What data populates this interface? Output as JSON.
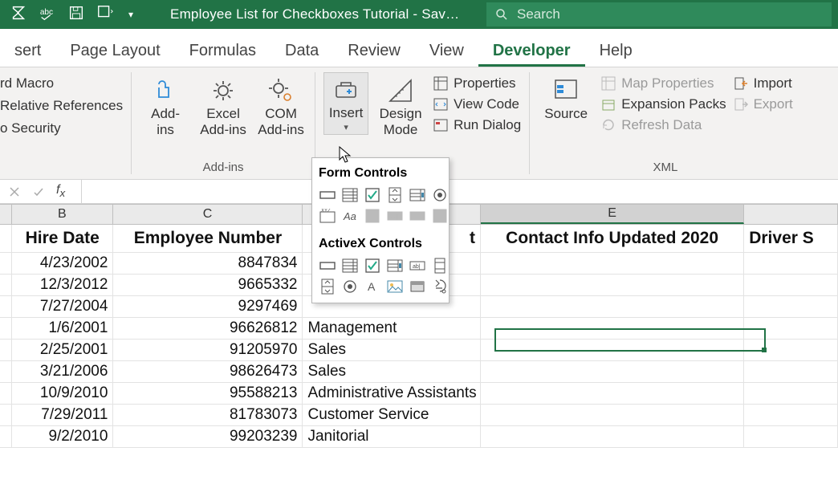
{
  "titlebar": {
    "title": "Employee List for Checkboxes Tutorial  -  Sav…",
    "search_placeholder": "Search"
  },
  "tabs": [
    "sert",
    "Page Layout",
    "Formulas",
    "Data",
    "Review",
    "View",
    "Developer",
    "Help"
  ],
  "active_tab": "Developer",
  "ribbon": {
    "code": {
      "items": [
        "rd Macro",
        "Relative References",
        "o Security"
      ]
    },
    "addins": {
      "label": "Add-ins",
      "buttons": [
        "Add-\nins",
        "Excel\nAdd-ins",
        "COM\nAdd-ins"
      ]
    },
    "controls": {
      "insert": "Insert",
      "design": "Design\nMode",
      "properties": "Properties",
      "view_code": "View Code",
      "run_dialog": "Run Dialog"
    },
    "xml": {
      "label": "XML",
      "source": "Source",
      "map_props": "Map Properties",
      "expansion": "Expansion Packs",
      "refresh": "Refresh Data",
      "import": "Import",
      "export": "Export"
    }
  },
  "popup": {
    "form_label": "Form Controls",
    "activex_label": "ActiveX Controls"
  },
  "grid": {
    "col_heads": [
      "B",
      "C",
      "",
      "E",
      ""
    ],
    "header_row": [
      "Hire Date",
      "Employee Number",
      "t",
      "Contact Info Updated 2020",
      "Driver S"
    ],
    "rows": [
      {
        "b": "4/23/2002",
        "c": "8847834",
        "d": ""
      },
      {
        "b": "12/3/2012",
        "c": "9665332",
        "d": ""
      },
      {
        "b": "7/27/2004",
        "c": "9297469",
        "d": ""
      },
      {
        "b": "1/6/2001",
        "c": "96626812",
        "d": "Management"
      },
      {
        "b": "2/25/2001",
        "c": "91205970",
        "d": "Sales"
      },
      {
        "b": "3/21/2006",
        "c": "98626473",
        "d": "Sales"
      },
      {
        "b": "10/9/2010",
        "c": "95588213",
        "d": "Administrative Assistants"
      },
      {
        "b": "7/29/2011",
        "c": "81783073",
        "d": "Customer Service"
      },
      {
        "b": "9/2/2010",
        "c": "99203239",
        "d": "Janitorial"
      }
    ]
  }
}
